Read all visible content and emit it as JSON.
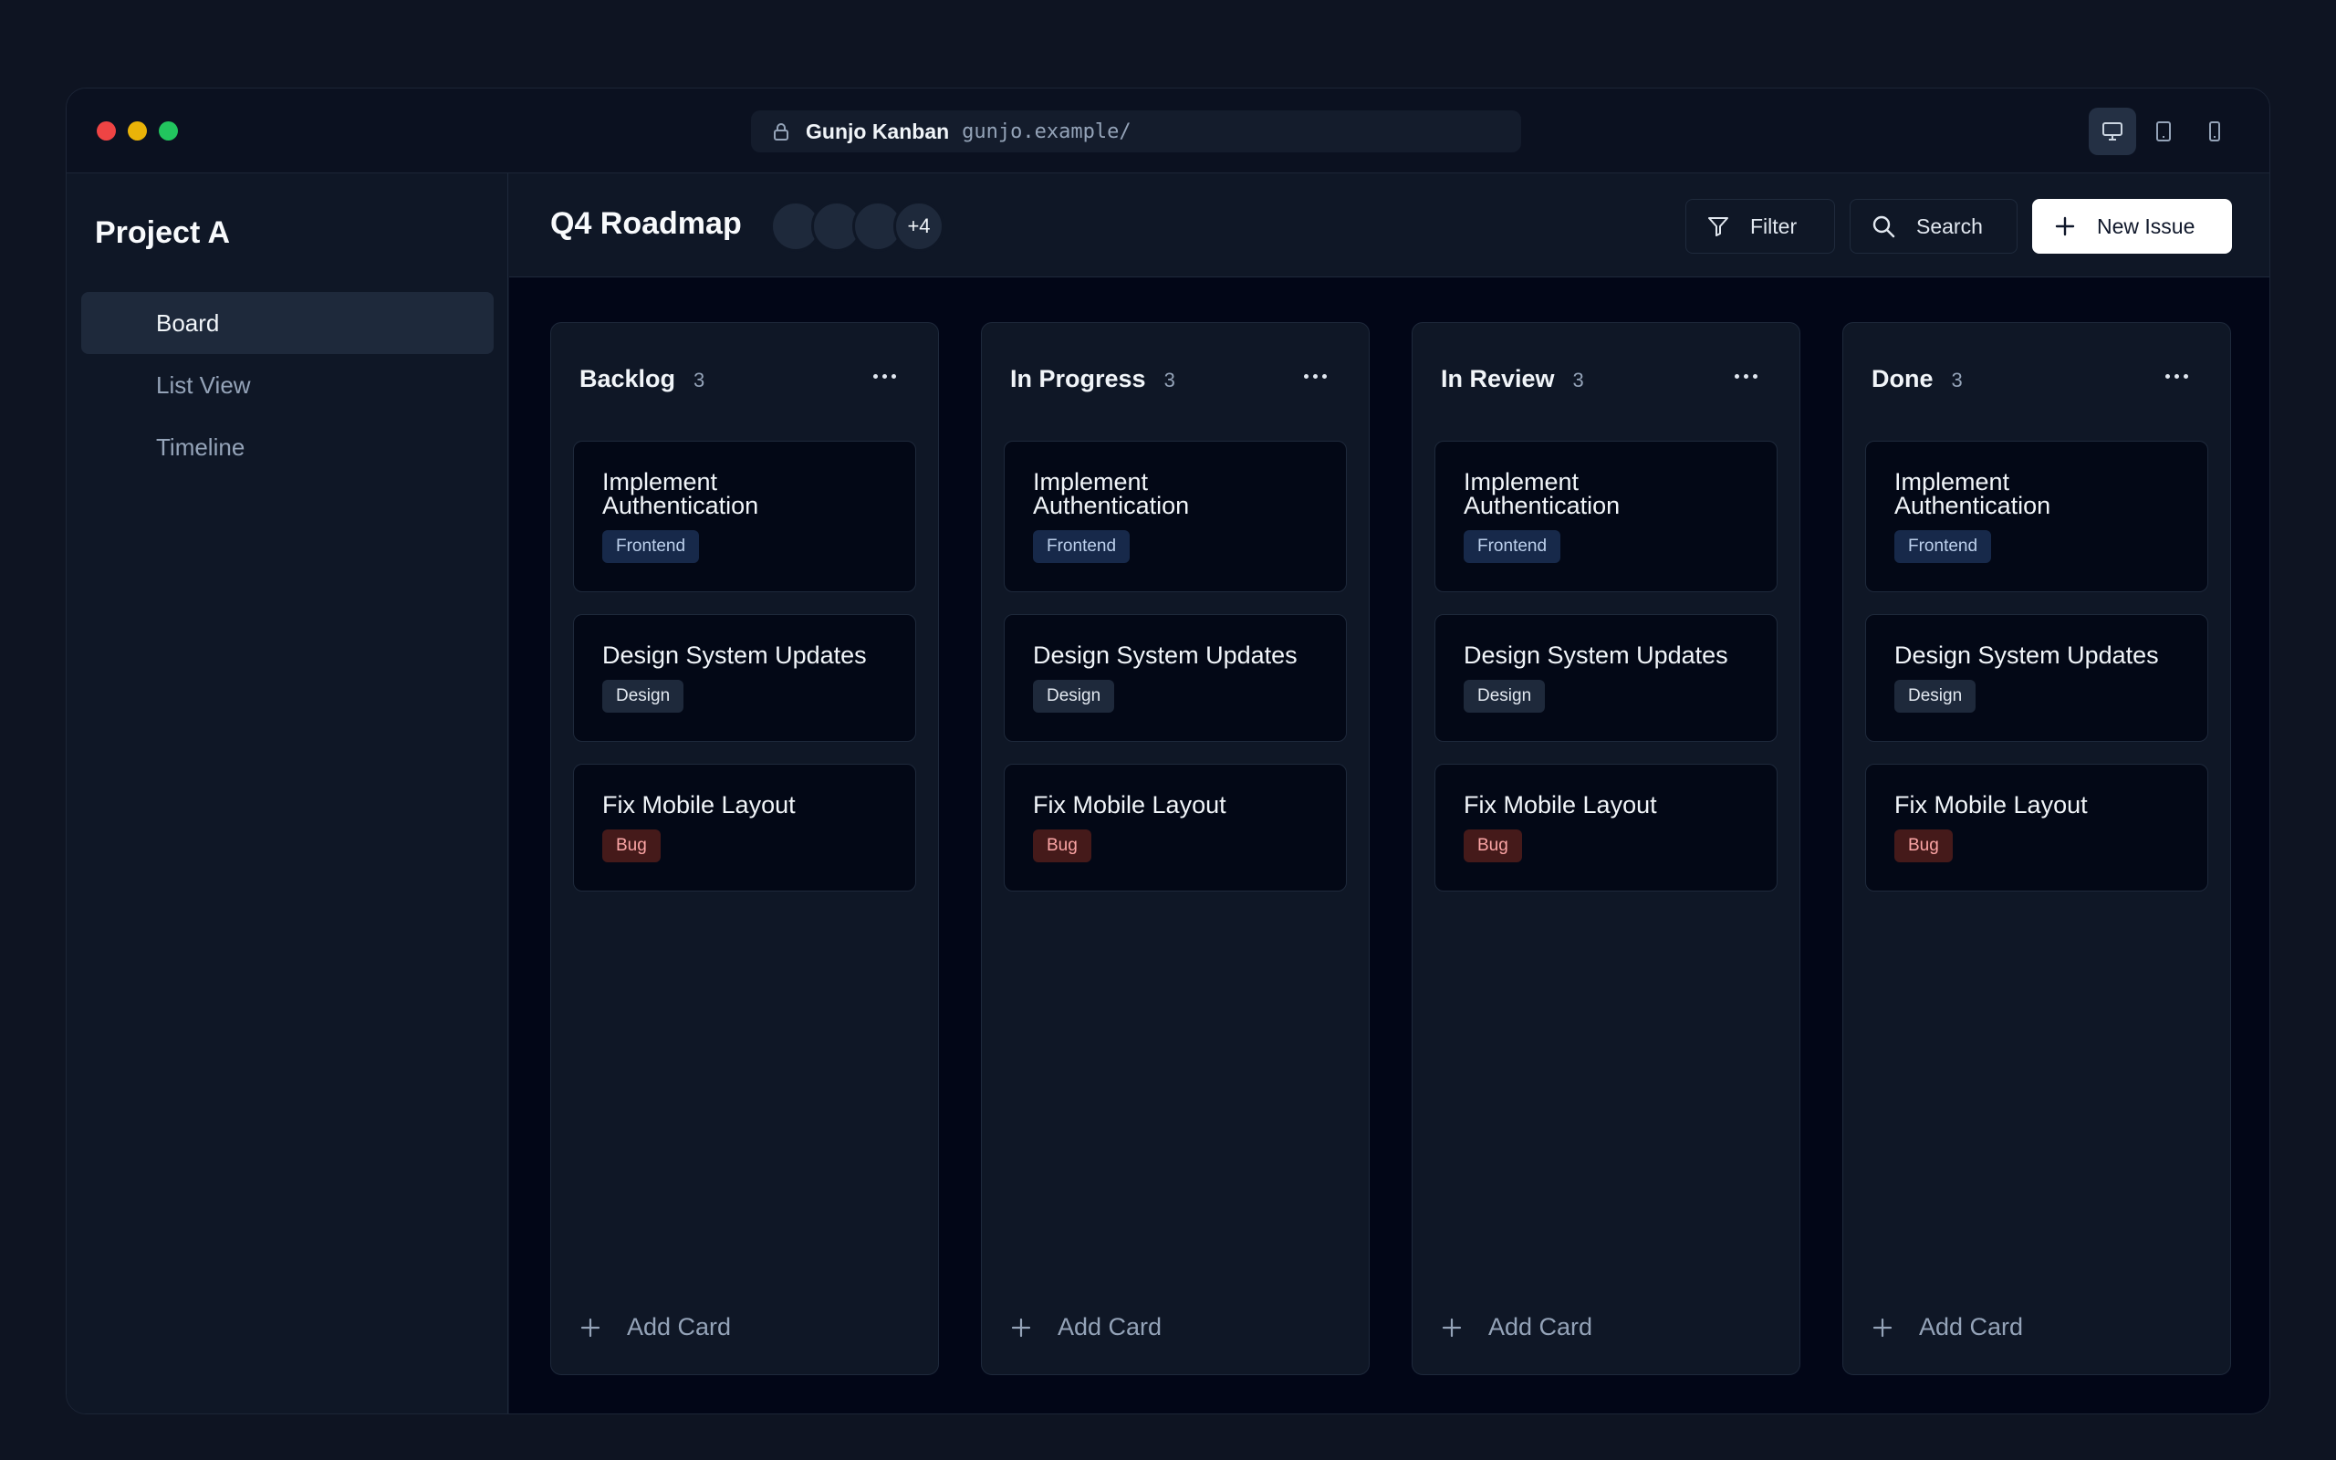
{
  "window": {
    "app_name": "Gunjo Kanban",
    "url": "gunjo.example/",
    "device_buttons": [
      "desktop-icon",
      "tablet-icon",
      "mobile-icon"
    ]
  },
  "sidebar": {
    "project_title": "Project A",
    "items": [
      {
        "label": "Board",
        "active": true
      },
      {
        "label": "List View",
        "active": false
      },
      {
        "label": "Timeline",
        "active": false
      }
    ]
  },
  "header": {
    "title": "Q4 Roadmap",
    "avatars_more": "+4",
    "filter_label": "Filter",
    "search_label": "Search",
    "new_issue_label": "New Issue"
  },
  "columns": [
    {
      "title": "Backlog",
      "count": "3"
    },
    {
      "title": "In Progress",
      "count": "3"
    },
    {
      "title": "In Review",
      "count": "3"
    },
    {
      "title": "Done",
      "count": "3"
    }
  ],
  "cards": [
    {
      "title_line1": "Implement",
      "title_line2": "Authentication",
      "tag": "Frontend"
    },
    {
      "title": "Design System Updates",
      "tag": "Design"
    },
    {
      "title": "Fix Mobile Layout",
      "tag": "Bug"
    }
  ],
  "add_card_label": "Add Card",
  "colors": {
    "background": "#020617",
    "surface": "#0f1726",
    "tag_frontend": "#17294a",
    "tag_design": "#1e293b",
    "tag_bug": "#451a1a",
    "primary_button": "#ffffff"
  }
}
